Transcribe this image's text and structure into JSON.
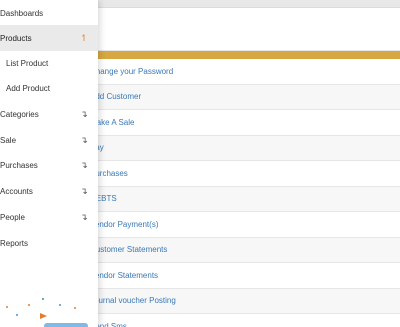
{
  "sidebar": {
    "items": [
      {
        "label": "Dashboards",
        "arrow": ""
      },
      {
        "label": "Products",
        "arrow": "↿"
      },
      {
        "label": "List Product",
        "arrow": ""
      },
      {
        "label": "Add Product",
        "arrow": ""
      },
      {
        "label": "Categories",
        "arrow": "↴"
      },
      {
        "label": "Sale",
        "arrow": "↴"
      },
      {
        "label": "Purchases",
        "arrow": "↴"
      },
      {
        "label": "Accounts",
        "arrow": "↴"
      },
      {
        "label": "People",
        "arrow": "↴"
      },
      {
        "label": "Reports",
        "arrow": ""
      }
    ]
  },
  "quick_links": [
    "Change your Password",
    "Add Customer",
    "Make A Sale",
    "Pay",
    "Purchases",
    "DEBTS",
    "Vendor Payment(s)",
    "Customer Statements",
    "Vendor Statements",
    "Journal voucher Posting",
    "Send Sms"
  ],
  "colors": {
    "accent_bar": "#d7a741",
    "link": "#3a78b5",
    "active_arrow": "#e07b2e"
  }
}
